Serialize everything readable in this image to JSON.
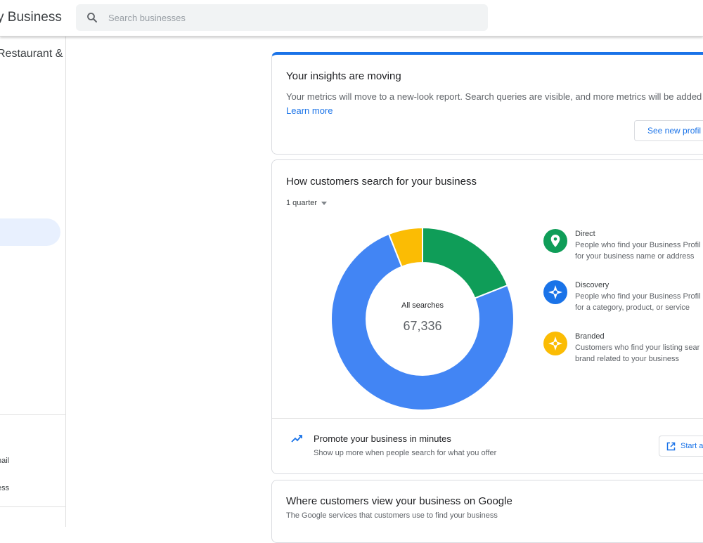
{
  "header": {
    "app_title": "Business",
    "search_placeholder": "Search businesses"
  },
  "sidebar": {
    "business_name": "Restaurant &",
    "links": [
      "nail",
      "ess"
    ]
  },
  "insights_card": {
    "title": "Your insights are moving",
    "body": "Your metrics will move to a new-look report. Search queries are visible, and more metrics will be added i",
    "link": "Learn more",
    "button": "See new profil"
  },
  "search_card": {
    "title": "How customers search for your business",
    "period": "1 quarter",
    "chart_data": {
      "type": "pie",
      "center_label": "All searches",
      "total": "67,336",
      "segments": [
        {
          "name": "Direct",
          "percent": 19,
          "color": "#0f9d58"
        },
        {
          "name": "Discovery",
          "percent": 75,
          "color": "#4285f4"
        },
        {
          "name": "Branded",
          "percent": 6,
          "color": "#fbbc04"
        }
      ]
    },
    "legend": [
      {
        "name": "Direct",
        "desc1": "People who find your Business Profil",
        "desc2": "for your business name or address",
        "color": "#0f9d58",
        "icon": "pin-icon"
      },
      {
        "name": "Discovery",
        "desc1": "People who find your Business Profil",
        "desc2": "for a category, product, or service",
        "color": "#1a73e8",
        "icon": "discovery-icon"
      },
      {
        "name": "Branded",
        "desc1": "Customers who find your listing sear",
        "desc2": "brand related to your business",
        "color": "#fbbc04",
        "icon": "branded-icon"
      }
    ],
    "promo": {
      "title": "Promote your business in minutes",
      "subtitle": "Show up more when people search for what you offer",
      "button": "Start a"
    }
  },
  "view_card": {
    "title": "Where customers view your business on Google",
    "subtitle": "The Google services that customers use to find your business"
  }
}
